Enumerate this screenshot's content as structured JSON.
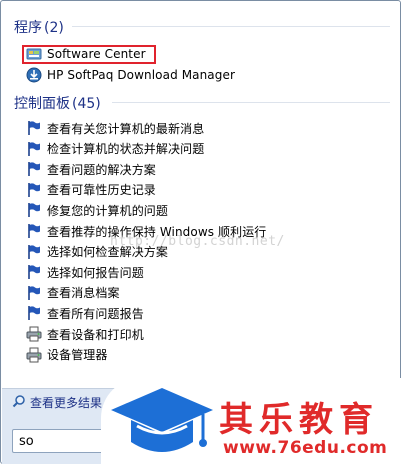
{
  "programs": {
    "title": "程序",
    "count": "(2)",
    "items": [
      {
        "label": "Software Center",
        "icon": "software-center-icon"
      },
      {
        "label": "HP SoftPaq Download Manager",
        "icon": "download-manager-icon"
      }
    ]
  },
  "control_panel": {
    "title": "控制面板",
    "count": "(45)",
    "items": [
      {
        "label": "查看有关您计算机的最新消息",
        "icon": "flag-icon"
      },
      {
        "label": "检查计算机的状态并解决问题",
        "icon": "flag-icon"
      },
      {
        "label": "查看问题的解决方案",
        "icon": "flag-icon"
      },
      {
        "label": "查看可靠性历史记录",
        "icon": "flag-icon"
      },
      {
        "label": "修复您的计算机的问题",
        "icon": "flag-icon"
      },
      {
        "label": "查看推荐的操作保持 Windows 顺利运行",
        "icon": "flag-icon"
      },
      {
        "label": "选择如何检查解决方案",
        "icon": "flag-icon"
      },
      {
        "label": "选择如何报告问题",
        "icon": "flag-icon"
      },
      {
        "label": "查看消息档案",
        "icon": "flag-icon"
      },
      {
        "label": "查看所有问题报告",
        "icon": "flag-icon"
      },
      {
        "label": "查看设备和打印机",
        "icon": "printer-icon"
      },
      {
        "label": "设备管理器",
        "icon": "printer-icon"
      }
    ]
  },
  "watermark": "http://blog.csdn.net/",
  "bottom": {
    "see_more": "查看更多结果",
    "search_value": "so"
  },
  "logo": {
    "name": "其乐教育",
    "url": "www.76edu.com"
  },
  "colors": {
    "header_blue": "#1e3287",
    "highlight_red": "#e0232d",
    "logo_red": "#e02a2a",
    "logo_blue": "#1d6fd6",
    "panel_bg": "#dfe8f4"
  }
}
